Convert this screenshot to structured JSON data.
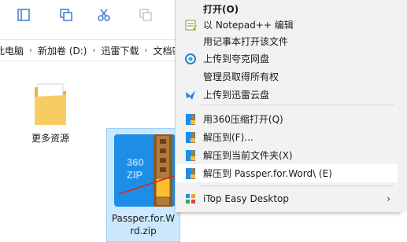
{
  "breadcrumb": [
    "此电脑",
    "新加卷 (D:)",
    "迅雷下载",
    "文档密"
  ],
  "files": [
    {
      "name": "更多资源",
      "type": "folder"
    },
    {
      "name_line1": "Passper.for.W",
      "name_line2": "rd.zip",
      "type": "zip",
      "selected": true
    }
  ],
  "zip_icon_text": {
    "top": "360",
    "bottom": "ZIP"
  },
  "context_menu": [
    {
      "label": "打开(O)",
      "icon": "none",
      "bold": true
    },
    {
      "label": "以 Notepad++ 编辑",
      "icon": "notepad-icon"
    },
    {
      "label": "用记事本打开该文件",
      "icon": "none"
    },
    {
      "label": "上传到夸克网盘",
      "icon": "cloud-icon"
    },
    {
      "label": "管理员取得所有权",
      "icon": "none"
    },
    {
      "label": "上传到迅雷云盘",
      "icon": "bird-icon"
    },
    {
      "label": "用360压缩打开(Q)",
      "icon": "zip-icon"
    },
    {
      "label": "解压到(F)...",
      "icon": "zip-icon"
    },
    {
      "label": "解压到当前文件夹(X)",
      "icon": "zip-icon"
    },
    {
      "label": "解压到 Passper.for.Word\\ (E)",
      "icon": "zip-icon",
      "highlighted": true
    },
    {
      "label": "iTop Easy Desktop",
      "icon": "grid-icon",
      "submenu_arrow": "›"
    }
  ],
  "colors": {
    "menu_bg": "#f2f2f2",
    "selection": "#cce8ff",
    "annotation_arrow": "#e02020",
    "zip_blue": "#1e8de6",
    "folder_yellow": "#f4c558"
  }
}
